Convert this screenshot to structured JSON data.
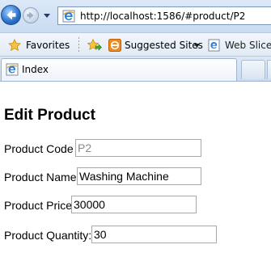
{
  "browser": {
    "address": "http://localhost:1586/#product/P2",
    "favorites_bar": {
      "favorites_label": "Favorites",
      "suggested_sites_label": "Suggested Sites",
      "web_slice_label": "Web Slice G"
    },
    "tabs": [
      {
        "label": "Index",
        "active": true
      }
    ]
  },
  "page": {
    "title": "Edit Product",
    "form": {
      "product_code": {
        "label": "Product Code :",
        "value": "P2",
        "readonly": true
      },
      "product_name": {
        "label": "Product Name:",
        "value": "Washing Machine"
      },
      "product_price": {
        "label": "Product Price:",
        "value": "30000"
      },
      "product_quantity": {
        "label": "Product Quantity:",
        "value": "30"
      }
    }
  },
  "colors": {
    "readonly_text": "#8a8a8a",
    "chrome_blue": "#c9dcf2",
    "back_button": "#2a6ec7"
  }
}
